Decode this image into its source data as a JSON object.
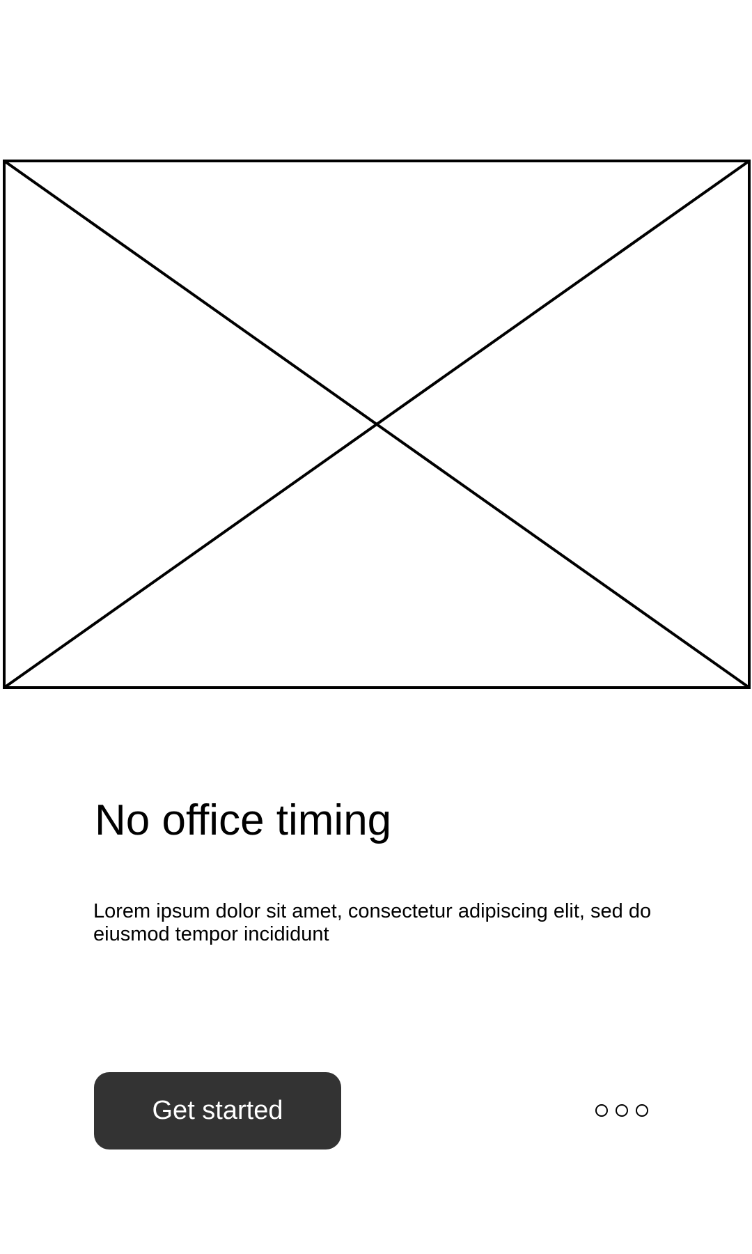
{
  "hero": {
    "image_icon": "image-placeholder-icon"
  },
  "content": {
    "title": "No office timing",
    "description": "Lorem ipsum dolor sit amet, consectetur adipiscing elit, sed do eiusmod tempor incididunt"
  },
  "footer": {
    "button_label": "Get started",
    "page_indicator": {
      "count": 3,
      "icon": "circle-outline-icon"
    }
  },
  "colors": {
    "background": "#ffffff",
    "button_background": "#333333",
    "button_text": "#ffffff",
    "text": "#000000",
    "placeholder_stroke": "#000000"
  }
}
